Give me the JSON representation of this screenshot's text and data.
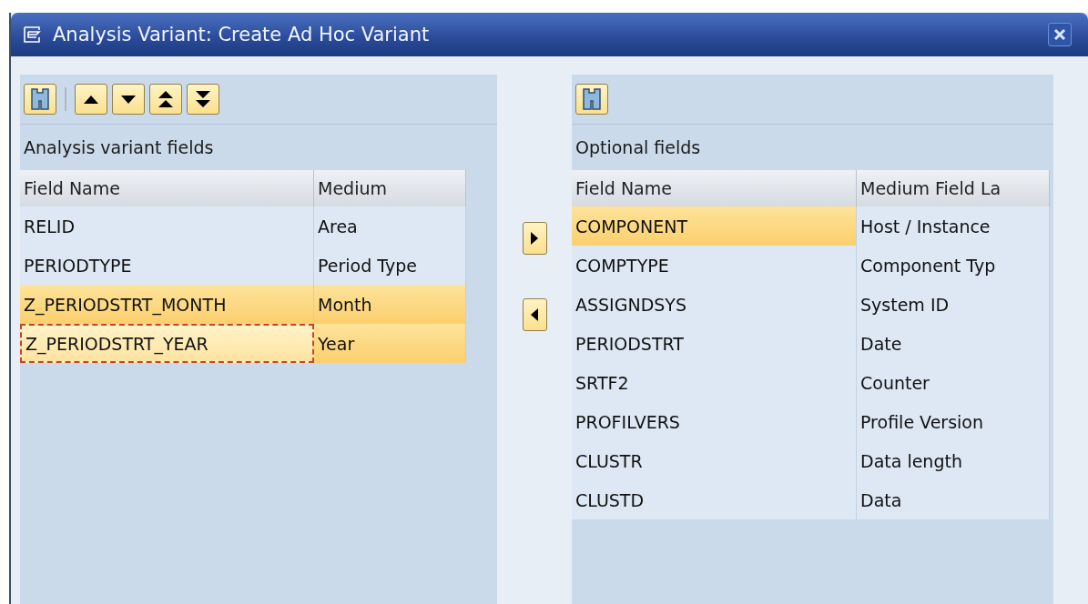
{
  "window": {
    "title": "Analysis Variant: Create Ad Hoc Variant"
  },
  "left_panel": {
    "toolbar": [
      {
        "kind": "find"
      },
      {
        "kind": "separator"
      },
      {
        "kind": "up"
      },
      {
        "kind": "down"
      },
      {
        "kind": "top"
      },
      {
        "kind": "bottom"
      }
    ],
    "label": "Analysis variant fields",
    "columns": [
      "Field Name",
      "Medium"
    ],
    "rows": [
      {
        "cells": [
          "RELID",
          "Area"
        ],
        "selected": false,
        "focused": false
      },
      {
        "cells": [
          "PERIODTYPE",
          "Period Type"
        ],
        "selected": false,
        "focused": false
      },
      {
        "cells": [
          "Z_PERIODSTRT_MONTH",
          "Month"
        ],
        "selected": true,
        "focused": false
      },
      {
        "cells": [
          "Z_PERIODSTRT_YEAR",
          "Year"
        ],
        "selected": true,
        "focused": true
      }
    ]
  },
  "transfer_buttons": [
    {
      "kind": "right"
    },
    {
      "kind": "left"
    }
  ],
  "right_panel": {
    "toolbar": [
      {
        "kind": "find"
      }
    ],
    "label": "Optional fields",
    "columns": [
      "Field Name",
      "Medium Field La"
    ],
    "rows": [
      {
        "cells": [
          "COMPONENT",
          "Host / Instance"
        ],
        "selected": true,
        "focused": false
      },
      {
        "cells": [
          "COMPTYPE",
          "Component Typ"
        ],
        "selected": false,
        "focused": false
      },
      {
        "cells": [
          "ASSIGNDSYS",
          "System ID"
        ],
        "selected": false,
        "focused": false
      },
      {
        "cells": [
          "PERIODSTRT",
          "Date"
        ],
        "selected": false,
        "focused": false
      },
      {
        "cells": [
          "SRTF2",
          "Counter"
        ],
        "selected": false,
        "focused": false
      },
      {
        "cells": [
          "PROFILVERS",
          "Profile Version"
        ],
        "selected": false,
        "focused": false
      },
      {
        "cells": [
          "CLUSTR",
          "Data length"
        ],
        "selected": false,
        "focused": false
      },
      {
        "cells": [
          "CLUSTD",
          "Data"
        ],
        "selected": false,
        "focused": false
      }
    ]
  }
}
